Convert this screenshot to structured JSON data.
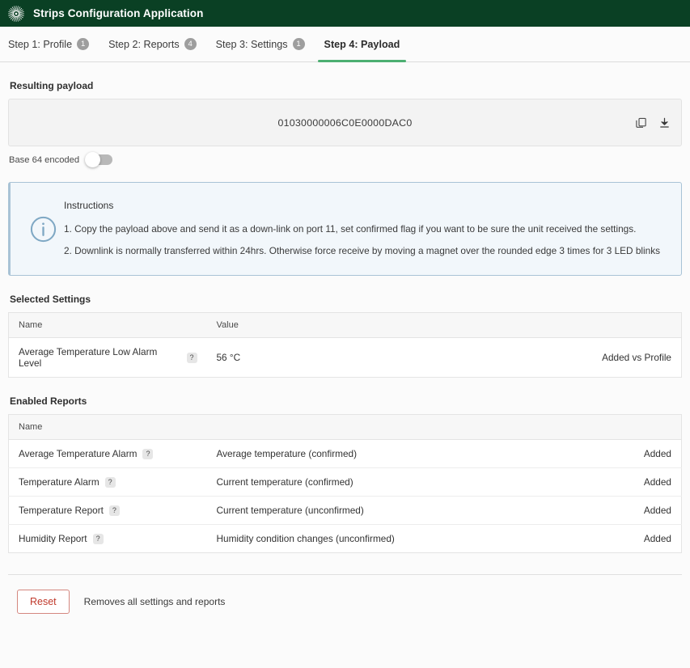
{
  "header": {
    "title": "Strips Configuration Application",
    "logo_icon": "starburst-logo-icon",
    "background_color": "#0a4024"
  },
  "tabs": {
    "accent_color": "#4caf72",
    "items": [
      {
        "label": "Step 1: Profile",
        "badge": "1",
        "active": false
      },
      {
        "label": "Step 2: Reports",
        "badge": "4",
        "active": false
      },
      {
        "label": "Step 3: Settings",
        "badge": "1",
        "active": false
      },
      {
        "label": "Step 4: Payload",
        "badge": "",
        "active": true
      }
    ]
  },
  "payload": {
    "section_label": "Resulting payload",
    "value": "01030000006C0E0000DAC0",
    "copy_icon": "copy-icon",
    "download_icon": "download-icon",
    "base64_label": "Base 64 encoded",
    "base64_enabled": false
  },
  "instructions": {
    "icon": "info-circle-icon",
    "title": "Instructions",
    "lines": [
      "1. Copy the payload above and send it as a down-link on port 11, set confirmed flag if you want to be sure the unit received the settings.",
      "2. Downlink is normally transferred within 24hrs. Otherwise force receive by moving a magnet over the rounded edge 3 times for 3 LED blinks"
    ],
    "background_color": "#f2f7fb",
    "border_color": "#a9c3d6"
  },
  "selected_settings": {
    "section_label": "Selected Settings",
    "columns": [
      "Name",
      "Value"
    ],
    "rows": [
      {
        "name": "Average Temperature Low Alarm Level",
        "help": "?",
        "value": "56 °C",
        "status": "Added vs Profile"
      }
    ]
  },
  "enabled_reports": {
    "section_label": "Enabled Reports",
    "columns": [
      "Name"
    ],
    "rows": [
      {
        "name": "Average Temperature Alarm",
        "help": "?",
        "description": "Average temperature (confirmed)",
        "status": "Added"
      },
      {
        "name": "Temperature Alarm",
        "help": "?",
        "description": "Current temperature (confirmed)",
        "status": "Added"
      },
      {
        "name": "Temperature Report",
        "help": "?",
        "description": "Current temperature (unconfirmed)",
        "status": "Added"
      },
      {
        "name": "Humidity Report",
        "help": "?",
        "description": "Humidity condition changes (unconfirmed)",
        "status": "Added"
      }
    ]
  },
  "footer": {
    "reset_label": "Reset",
    "hint": "Removes all settings and reports",
    "reset_color": "#c0392b"
  }
}
